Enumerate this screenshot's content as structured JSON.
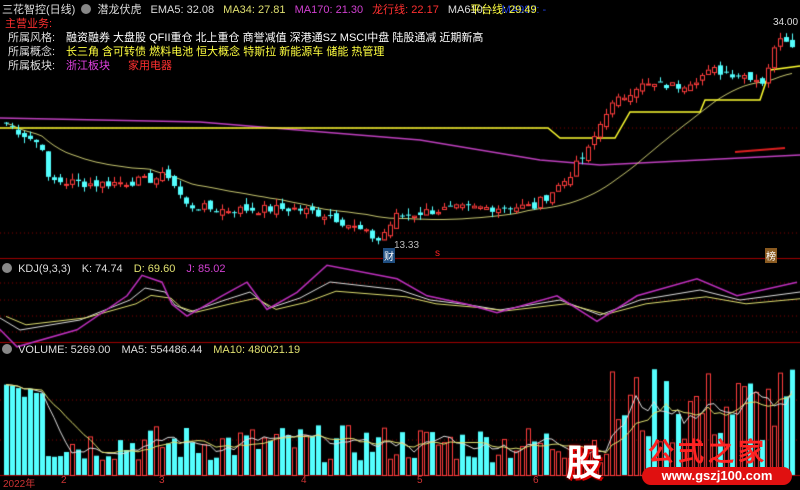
{
  "header": {
    "title": "三花智控(日线)",
    "indicator_name": "潜龙伏虎",
    "ema5": "EMA5: 32.08",
    "ma34": "MA34: 27.81",
    "ma170": "MA170: 21.30",
    "dragon": "龙行线: 22.17",
    "ma610": "MA610: -",
    "ma987": "MA987: -",
    "platform": "平台线: 29.49"
  },
  "info": {
    "main_business": "主营业务:",
    "style_label": "所属风格:",
    "style_value": "融资融券 大盘股 QFII重仓 北上重仓 商誉减值 深港通SZ MSCI中盘 陆股通减 近期新高",
    "concept_label": "所属概念:",
    "concept_value": "长三角 含可转债 燃料电池 恒大概念 特斯拉 新能源车 储能 热管理",
    "sector_label": "所属板块:",
    "sector_a": "浙江板块",
    "sector_b": "家用电器"
  },
  "annotations": {
    "high": "34.00",
    "low": "13.33",
    "marker_cai": "财",
    "marker_s": "s",
    "marker_bang": "榜"
  },
  "kdj": {
    "name": "KDJ(9,3,3)",
    "k": "K: 74.74",
    "d": "D: 69.60",
    "j": "J: 85.02"
  },
  "volume": {
    "name": "VOLUME: 5269.00",
    "ma5": "MA5: 554486.44",
    "ma10": "MA10: 480021.19"
  },
  "xaxis": {
    "labels": [
      "2022年",
      "2",
      "3",
      "4",
      "5",
      "6"
    ]
  },
  "watermark": {
    "char": "股",
    "brand": "公式之家",
    "url": "www.gszj100.com"
  },
  "colors": {
    "up": "#ff3c3c",
    "down": "#54ffff",
    "platform": "#ffff30",
    "ma170": "#c040c0",
    "ma34": "#c8c870",
    "grid": "#8b0000"
  },
  "price_keypoints": [
    [
      0,
      24.6
    ],
    [
      6,
      22.5
    ],
    [
      7,
      19.3
    ],
    [
      15,
      19.0
    ],
    [
      23,
      19.3
    ],
    [
      27,
      19.8
    ],
    [
      30,
      17.0
    ],
    [
      35,
      16.6
    ],
    [
      48,
      16.7
    ],
    [
      54,
      16.1
    ],
    [
      62,
      13.8
    ],
    [
      65,
      16.0
    ],
    [
      72,
      16.6
    ],
    [
      84,
      16.9
    ],
    [
      88,
      16.9
    ],
    [
      93,
      19.3
    ],
    [
      97,
      22.1
    ],
    [
      100,
      25.8
    ],
    [
      105,
      28.1
    ],
    [
      112,
      28.1
    ],
    [
      118,
      29.5
    ],
    [
      124,
      29.0
    ],
    [
      126,
      28.5
    ],
    [
      129,
      32.8
    ],
    [
      131,
      32.1
    ]
  ]
}
